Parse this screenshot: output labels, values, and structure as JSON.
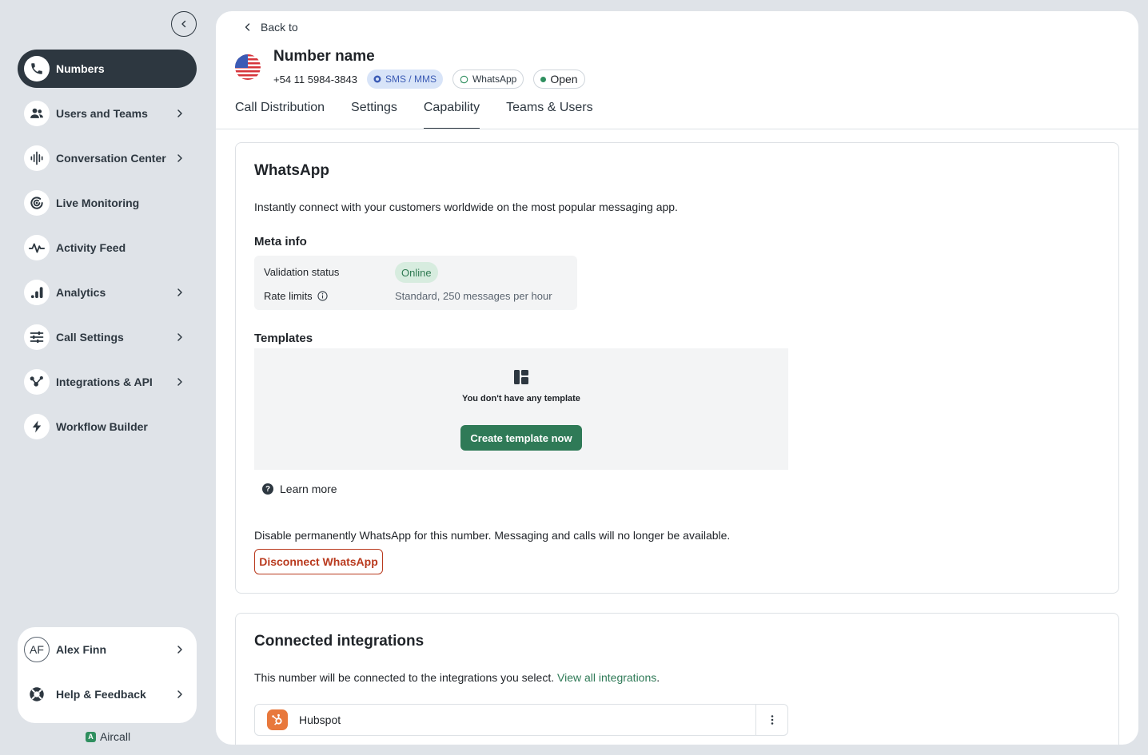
{
  "sidebar": {
    "items": [
      {
        "label": "Numbers",
        "icon": "phone-icon",
        "active": true,
        "chevron": false
      },
      {
        "label": "Users and Teams",
        "icon": "users-icon",
        "chevron": true
      },
      {
        "label": "Conversation Center",
        "icon": "waveform-icon",
        "chevron": true
      },
      {
        "label": "Live Monitoring",
        "icon": "live-monitoring-icon",
        "chevron": false
      },
      {
        "label": "Activity Feed",
        "icon": "pulse-icon",
        "chevron": false
      },
      {
        "label": "Analytics",
        "icon": "bar-chart-icon",
        "chevron": true
      },
      {
        "label": "Call Settings",
        "icon": "sliders-icon",
        "chevron": true
      },
      {
        "label": "Integrations & API",
        "icon": "integrations-icon",
        "chevron": true
      },
      {
        "label": "Workflow Builder",
        "icon": "bolt-icon",
        "chevron": false
      }
    ],
    "user": {
      "initials": "AF",
      "name": "Alex Finn"
    },
    "help": {
      "label": "Help & Feedback"
    },
    "brand": "Aircall"
  },
  "header": {
    "back_label": "Back to",
    "number_name": "Number name",
    "phone": "+54 11 5984-3843",
    "badges": {
      "sms": "SMS / MMS",
      "whatsapp": "WhatsApp",
      "status": "Open"
    },
    "tabs": [
      "Call Distribution",
      "Settings",
      "Capability",
      "Teams & Users"
    ],
    "active_tab": "Capability"
  },
  "whatsapp": {
    "title": "WhatsApp",
    "description": "Instantly connect with your customers worldwide on the most popular messaging app.",
    "meta_title": "Meta info",
    "validation_label": "Validation status",
    "validation_value": "Online",
    "rate_label": "Rate limits",
    "rate_value": "Standard, 250 messages per hour",
    "templates_title": "Templates",
    "templates_empty": "You don't have any template",
    "create_button": "Create template now",
    "learn_more": "Learn more",
    "disable_text": "Disable permanently WhatsApp for this number. Messaging and calls will no longer be available.",
    "disconnect_button": "Disconnect WhatsApp"
  },
  "integrations": {
    "title": "Connected integrations",
    "description": "This number will be connected to the integrations you select.",
    "link": "View all integrations",
    "link_suffix": ".",
    "items": [
      {
        "name": "Hubspot"
      }
    ]
  },
  "colors": {
    "accent": "#2f7a57",
    "danger": "#b93a1e",
    "dark": "#2d3740"
  }
}
